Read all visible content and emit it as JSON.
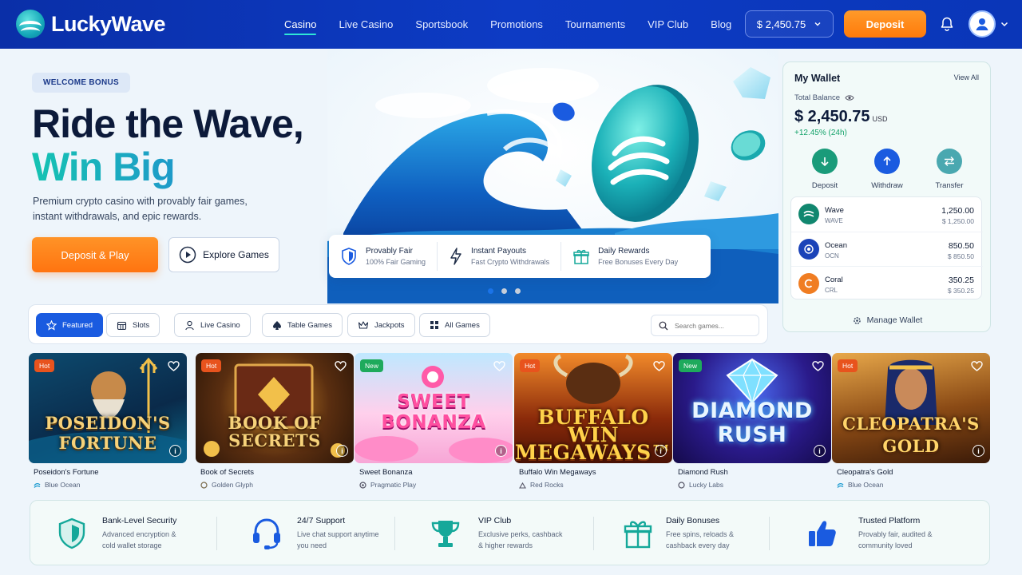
{
  "header": {
    "brand": "LuckyWave",
    "nav": [
      "Casino",
      "Live Casino",
      "Sportsbook",
      "Promotions",
      "Tournaments",
      "VIP Club",
      "Blog"
    ],
    "balance": "$ 2,450.75",
    "deposit_label": "Deposit"
  },
  "hero": {
    "badge": "WELCOME BONUS",
    "title_line1": "Ride the Wave,",
    "title_line2": "Win Big",
    "subtitle": "Premium crypto casino with provably fair games, instant withdrawals, and epic rewards.",
    "primary_cta": "Deposit & Play",
    "secondary_cta": "Explore Games",
    "features": [
      {
        "title": "Provably Fair",
        "desc": "100% Fair Gaming",
        "icon": "shield-icon"
      },
      {
        "title": "Instant Payouts",
        "desc": "Fast Crypto Withdrawals",
        "icon": "lightning-icon"
      },
      {
        "title": "Daily Rewards",
        "desc": "Free Bonuses Every Day",
        "icon": "gift-icon"
      }
    ],
    "carousel_active_index": 0,
    "carousel_count": 3
  },
  "wallet": {
    "title": "My Wallet",
    "view_all": "View All",
    "total_label": "Total Balance",
    "total_amount": "$ 2,450.75",
    "currency": "USD",
    "change": "+12.45% (24h)",
    "actions": [
      {
        "label": "Deposit",
        "icon": "arrow-down-icon",
        "color": "#1a9b7a"
      },
      {
        "label": "Withdraw",
        "icon": "arrow-up-icon",
        "color": "#1a5be0"
      },
      {
        "label": "Transfer",
        "icon": "transfer-icon",
        "color": "#4aa8b0"
      }
    ],
    "coins": [
      {
        "name": "Wave",
        "symbol": "WAVE",
        "amount": "1,250.00",
        "usd": "$ 1,250.00",
        "color": "#11876f"
      },
      {
        "name": "Ocean",
        "symbol": "OCN",
        "amount": "850.50",
        "usd": "$ 850.50",
        "color": "#1b43b8"
      },
      {
        "name": "Coral",
        "symbol": "CRL",
        "amount": "350.25",
        "usd": "$ 350.25",
        "color": "#f07d22"
      }
    ],
    "manage": "Manage Wallet"
  },
  "categories": {
    "items": [
      "Featured",
      "Slots",
      "Live Casino",
      "Table Games",
      "Jackpots",
      "All Games"
    ],
    "active": "Featured",
    "search_placeholder": "Search games..."
  },
  "games": [
    {
      "title": "Poseidon's Fortune",
      "provider": "Blue Ocean",
      "tag": "Hot",
      "art": "POSEIDON'S FORTUNE"
    },
    {
      "title": "Book of Secrets",
      "provider": "Golden Glyph",
      "tag": "Hot",
      "art": "BOOK OF SECRETS"
    },
    {
      "title": "Sweet Bonanza",
      "provider": "Pragmatic Play",
      "tag": "New",
      "art": "SWEET BONANZA"
    },
    {
      "title": "Buffalo Win Megaways",
      "provider": "Red Rocks",
      "tag": "Hot",
      "art": "BUFFALO WIN MEGAWAYS™"
    },
    {
      "title": "Diamond Rush",
      "provider": "Lucky Labs",
      "tag": "New",
      "art": "DIAMOND RUSH"
    },
    {
      "title": "Cleopatra's Gold",
      "provider": "Blue Ocean",
      "tag": "Hot",
      "art": "CLEOPATRA'S GOLD"
    }
  ],
  "trust": [
    {
      "title": "Bank-Level Security",
      "desc": "Advanced encryption & cold wallet storage",
      "icon": "shield-icon"
    },
    {
      "title": "24/7 Support",
      "desc": "Live chat support anytime you need",
      "icon": "headset-icon"
    },
    {
      "title": "VIP Club",
      "desc": "Exclusive perks, cashback & higher rewards",
      "icon": "trophy-icon"
    },
    {
      "title": "Daily Bonuses",
      "desc": "Free spins, reloads & cashback every day",
      "icon": "gift-icon"
    },
    {
      "title": "Trusted Platform",
      "desc": "Provably fair, audited & community loved",
      "icon": "thumbs-up-icon"
    }
  ],
  "colors": {
    "header": "#0d3bc4",
    "accent_orange": "#ff7a0a",
    "accent_teal": "#15c3b2",
    "primary_blue": "#1a5be0"
  }
}
